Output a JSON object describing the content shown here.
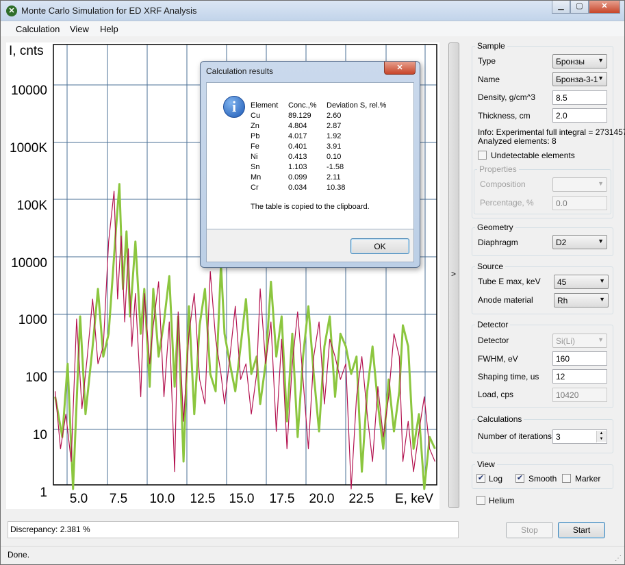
{
  "window": {
    "title": "Monte Carlo Simulation for ED XRF Analysis",
    "minimize": "▁",
    "maximize": "▢",
    "close": "✕"
  },
  "menu": [
    "Calculation",
    "View",
    "Help"
  ],
  "chart_data": {
    "type": "line",
    "ylabel": "I, cnts",
    "xlabel": "E, keV",
    "y_scale": "log",
    "ylim": [
      1,
      100000
    ],
    "y_tick_labels": [
      "1",
      "10",
      "100",
      "1000",
      "10000",
      "100K",
      "1000K",
      "10000"
    ],
    "x_tick_labels": [
      "5.0",
      "7.5",
      "10.0",
      "12.5",
      "15.0",
      "17.5",
      "20.0",
      "22.5"
    ],
    "xlim": [
      3.5,
      25.0
    ],
    "grid": true,
    "series": [
      {
        "color": "#8cc63f",
        "x": [
          3.6,
          4.0,
          4.3,
          4.6,
          5.0,
          5.3,
          5.7,
          6.0,
          6.3,
          6.6,
          7.0,
          7.2,
          7.4,
          7.6,
          7.8,
          8.1,
          8.4,
          8.6,
          8.9,
          9.1,
          9.4,
          9.7,
          10.0,
          10.3,
          10.5,
          10.8,
          11.1,
          11.4,
          11.7,
          12.0,
          12.3,
          12.6,
          12.9,
          13.1,
          13.4,
          13.7,
          14.0,
          14.3,
          14.6,
          14.9,
          15.1,
          15.4,
          15.7,
          16.0,
          16.3,
          16.6,
          16.9,
          17.2,
          17.5,
          17.8,
          18.1,
          18.4,
          18.7,
          19.0,
          19.3,
          19.6,
          19.9,
          20.2,
          20.5,
          20.8,
          21.1,
          21.4,
          21.7,
          22.0,
          22.3,
          22.6,
          22.9,
          23.1,
          23.4,
          23.7,
          24.0,
          24.3,
          24.6,
          24.9
        ],
        "y": [
          40,
          8,
          150,
          1,
          1000,
          20,
          300,
          3000,
          200,
          500,
          30000,
          200000,
          3000,
          30000,
          1000,
          20000,
          500,
          3000,
          60,
          3000,
          200,
          800,
          5000,
          60,
          1000,
          3,
          1500,
          20,
          700,
          3000,
          100,
          50,
          8000,
          500,
          150,
          50,
          300,
          2000,
          100,
          200,
          30,
          150,
          4000,
          200,
          1000,
          15,
          500,
          8,
          200,
          1500,
          100,
          10,
          300,
          1000,
          40,
          500,
          300,
          100,
          200,
          2,
          50,
          300,
          30,
          5,
          80,
          10,
          50,
          700,
          300,
          5,
          20,
          1,
          8,
          5
        ]
      },
      {
        "color": "#b3124f",
        "x": [
          3.6,
          3.9,
          4.2,
          4.5,
          4.8,
          5.1,
          5.4,
          5.7,
          6.0,
          6.3,
          6.6,
          6.9,
          7.1,
          7.3,
          7.5,
          7.7,
          7.9,
          8.1,
          8.4,
          8.6,
          8.9,
          9.1,
          9.4,
          9.7,
          10.0,
          10.3,
          10.5,
          10.8,
          11.1,
          11.4,
          11.7,
          12.0,
          12.3,
          12.6,
          12.9,
          13.1,
          13.4,
          13.7,
          14.0,
          14.3,
          14.6,
          14.9,
          15.1,
          15.4,
          15.7,
          16.0,
          16.3,
          16.6,
          16.9,
          17.2,
          17.5,
          17.8,
          18.1,
          18.4,
          18.7,
          19.0,
          19.3,
          19.6,
          19.9,
          20.2,
          20.5,
          20.8,
          21.1,
          21.4,
          21.7,
          22.0,
          22.3,
          22.6,
          22.9,
          23.1,
          23.4,
          23.7,
          24.0,
          24.3,
          24.6,
          24.9
        ],
        "y": [
          50,
          5,
          20,
          3,
          900,
          25,
          200,
          2000,
          150,
          300,
          20000,
          150000,
          2000,
          25000,
          800,
          15000,
          300,
          2500,
          40,
          2500,
          150,
          700,
          4000,
          40,
          800,
          2,
          1200,
          15,
          500,
          2500,
          80,
          30,
          6000,
          400,
          100,
          30,
          200,
          1500,
          80,
          150,
          20,
          100,
          3000,
          150,
          800,
          10,
          400,
          5,
          150,
          1200,
          80,
          5,
          200,
          800,
          30,
          400,
          200,
          80,
          150,
          1,
          40,
          200,
          20,
          3,
          60,
          8,
          40,
          500,
          200,
          3,
          15,
          2,
          10,
          40,
          5,
          3
        ]
      }
    ]
  },
  "splitter_arrow": ">",
  "discrepancy_text": "Discrepancy: 2.381 %",
  "status_text": "Done.",
  "sample": {
    "title": "Sample",
    "type_label": "Type",
    "type_value": "Бронзы",
    "name_label": "Name",
    "name_value": "Бронза-3-1",
    "density_label": "Density, g/cm^3",
    "density_value": "8.5",
    "thickness_label": "Thickness, cm",
    "thickness_value": "2.0",
    "info_line1": "Info: Experimental full integral =  2731457",
    "info_line2": "Analyzed elements: 8",
    "undetectable_label": "Undetectable elements",
    "properties_title": "Properties",
    "composition_label": "Composition",
    "percentage_label": "Percentage, %",
    "percentage_value": "0.0"
  },
  "geometry": {
    "title": "Geometry",
    "diaphragm_label": "Diaphragm",
    "diaphragm_value": "D2"
  },
  "source": {
    "title": "Source",
    "tube_label": "Tube E max, keV",
    "tube_value": "45",
    "anode_label": "Anode material",
    "anode_value": "Rh"
  },
  "detector": {
    "title": "Detector",
    "detector_label": "Detector",
    "detector_value": "Si(Li)",
    "fwhm_label": "FWHM, eV",
    "fwhm_value": "160",
    "shaping_label": "Shaping time, us",
    "shaping_value": "12",
    "load_label": "Load, cps",
    "load_value": "10420"
  },
  "calculations": {
    "title": "Calculations",
    "iterations_label": "Number of iterations",
    "iterations_value": "3"
  },
  "view": {
    "title": "View",
    "log_label": "Log",
    "smooth_label": "Smooth",
    "marker_label": "Marker"
  },
  "helium_label": "Helium",
  "stop_label": "Stop",
  "start_label": "Start",
  "dialog": {
    "title": "Calculation results",
    "close": "✕",
    "headers": [
      "Element",
      "Conc.,%",
      "Deviation S, rel.%"
    ],
    "rows": [
      [
        "Cu",
        "89.129",
        "2.60"
      ],
      [
        "Zn",
        "4.804",
        "2.87"
      ],
      [
        "Pb",
        "4.017",
        "1.92"
      ],
      [
        "Fe",
        "0.401",
        "3.91"
      ],
      [
        "Ni",
        "0.413",
        "0.10"
      ],
      [
        "Sn",
        "1.103",
        "-1.58"
      ],
      [
        "Mn",
        "0.099",
        "2.11"
      ],
      [
        "Cr",
        "0.034",
        "10.38"
      ]
    ],
    "note": "The table is copied to the clipboard.",
    "ok_label": "OK"
  }
}
